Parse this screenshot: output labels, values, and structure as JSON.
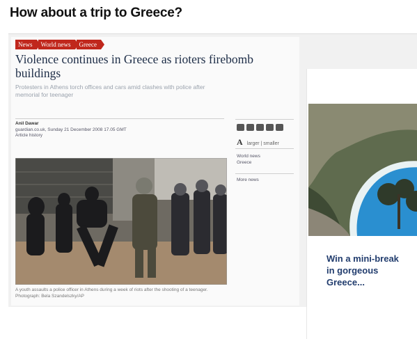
{
  "page": {
    "headline": "How about a trip to Greece?"
  },
  "article": {
    "breadcrumbs": [
      "News",
      "World news",
      "Greece"
    ],
    "title": "Violence continues in Greece as rioters firebomb buildings",
    "standfirst": "Protesters in Athens torch offices and cars amid clashes with police after memorial for teenager",
    "byline": {
      "author": "Anil Dawar",
      "dateline": "guardian.co.uk, Sunday 21 December 2008 17.05 GMT",
      "history": "Article history"
    },
    "caption": "A youth assaults a police officer in Athens during a week of riots after the shooting of a teenager. Photograph: Bela Szandelszky/AP"
  },
  "sidebar": {
    "share_icons": [
      "share-icon",
      "email-icon",
      "print-icon",
      "save-icon",
      "feed-icon"
    ],
    "text_size": {
      "glyph": "A",
      "label": "larger | smaller"
    },
    "section_link": {
      "line1": "World news",
      "line2": "Greece"
    },
    "more_news": "More news"
  },
  "ad": {
    "text": "Win a mini-break\nin gorgeous\nGreece..."
  },
  "colors": {
    "breadcrumb": "#c0271c",
    "title": "#1c2c46",
    "ad_text": "#223d6e",
    "sea": "#2a8fd0"
  }
}
